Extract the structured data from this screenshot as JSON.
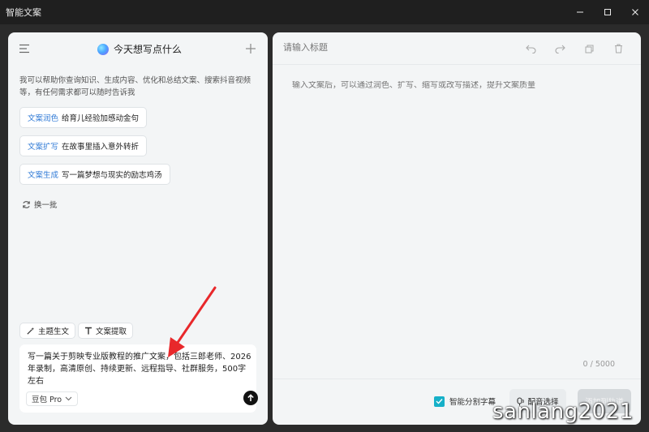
{
  "window": {
    "title": "智能文案"
  },
  "left": {
    "greeting": "今天想写点什么",
    "intro": "我可以帮助你查询知识、生成内容、优化和总结文案、搜索抖音视频等，有任何需求都可以随时告诉我",
    "suggestions": [
      {
        "tag": "文案润色",
        "text": "给育儿经验加感动金句"
      },
      {
        "tag": "文案扩写",
        "text": "在故事里插入意外转折"
      },
      {
        "tag": "文案生成",
        "text": "写一篇梦想与现实的励志鸡汤"
      }
    ],
    "refresh_label": "换一批",
    "tools": {
      "topic_label": "主题生文",
      "extract_label": "文案提取"
    },
    "compose": {
      "text": "写一篇关于剪映专业版教程的推广文案，包括三郎老师、2026年录制，高清原创、持续更新、远程指导、社群服务，500字左右",
      "model": "豆包 Pro"
    }
  },
  "right": {
    "title_placeholder": "请输入标题",
    "body_placeholder": "输入文案后，可以通过润色、扩写、缩写或改写描述，提升文案质量",
    "counter": "0 / 5000",
    "subtitle_label": "智能分割字幕",
    "voice_label": "配音选择",
    "generate_label": "添加到轨道"
  },
  "watermark": "sanlang2021",
  "colors": {
    "accent_blue": "#2f7ad6",
    "checkbox": "#16b0c8",
    "annotation_red": "#e8282b"
  }
}
